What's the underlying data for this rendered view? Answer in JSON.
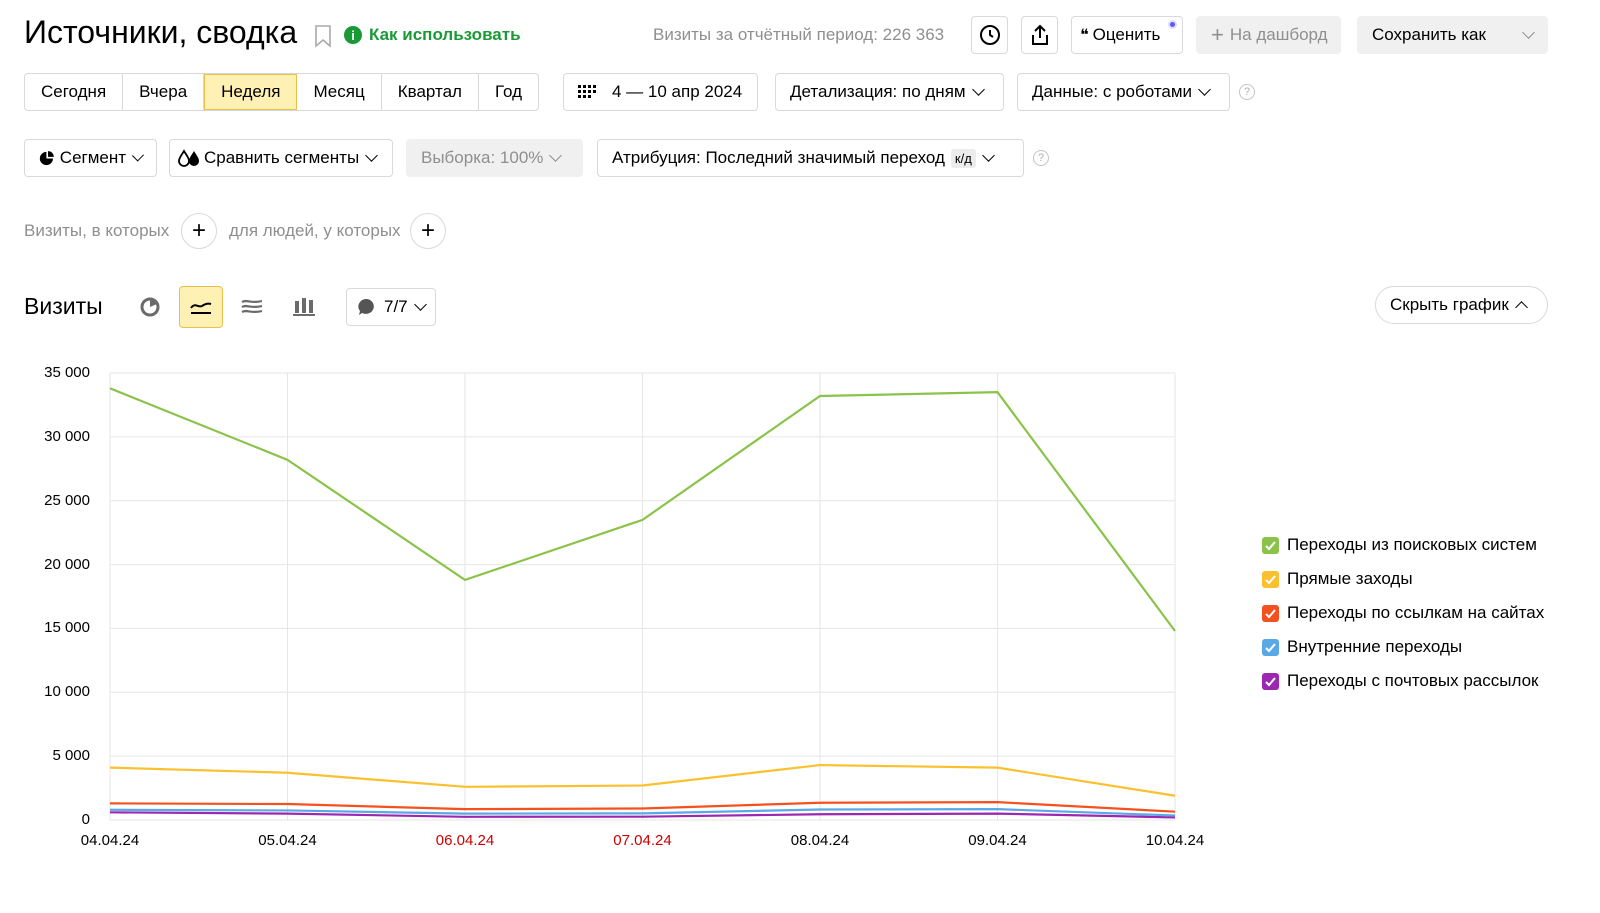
{
  "header": {
    "title": "Источники, сводка",
    "how_to_use": "Как использовать",
    "visits_period_label": "Визиты за отчётный период: 226 363",
    "rate_label": "Оценить",
    "dashboard_label": "На дашборд",
    "save_as_label": "Сохранить как"
  },
  "period_tabs": [
    "Сегодня",
    "Вчера",
    "Неделя",
    "Месяц",
    "Квартал",
    "Год"
  ],
  "active_period": "Неделя",
  "date_range": "4 — 10 апр 2024",
  "detail": "Детализация: по дням",
  "data_mode": "Данные: с роботами",
  "filters": {
    "segment": "Сегмент",
    "compare": "Сравнить сегменты",
    "sample": "Выборка: 100%",
    "attribution": "Атрибуция: Последний значимый переход",
    "attribution_badge": "к/д"
  },
  "conditions": {
    "visits_label": "Визиты, в которых",
    "people_label": "для людей, у которых"
  },
  "chart_section": {
    "title": "Визиты",
    "series_count": "7/7",
    "hide_chart": "Скрыть график"
  },
  "colors": {
    "accent_yellow": "#fff0b3",
    "green_info": "#1a9a35",
    "weekend": "#cc0000",
    "search": "#8bc34a",
    "direct": "#fbc02d",
    "links": "#f4511e",
    "internal": "#5aa9e6",
    "mail": "#9c27b0"
  },
  "chart_data": {
    "type": "line",
    "categories": [
      "04.04.24",
      "05.04.24",
      "06.04.24",
      "07.04.24",
      "08.04.24",
      "09.04.24",
      "10.04.24"
    ],
    "weekend_categories": [
      "06.04.24",
      "07.04.24"
    ],
    "y_ticks": [
      "0",
      "5 000",
      "10 000",
      "15 000",
      "20 000",
      "25 000",
      "30 000",
      "35 000"
    ],
    "ylim": [
      0,
      35000
    ],
    "grid": true,
    "legend_position": "right",
    "series": [
      {
        "name": "Переходы из поисковых систем",
        "color": "#8bc34a",
        "values": [
          33800,
          28200,
          18800,
          23500,
          33200,
          33500,
          14800
        ]
      },
      {
        "name": "Прямые заходы",
        "color": "#fbc02d",
        "values": [
          4100,
          3700,
          2600,
          2700,
          4300,
          4100,
          1900
        ]
      },
      {
        "name": "Переходы по ссылкам на сайтах",
        "color": "#f4511e",
        "values": [
          1300,
          1250,
          850,
          900,
          1350,
          1400,
          650
        ]
      },
      {
        "name": "Внутренние переходы",
        "color": "#5aa9e6",
        "values": [
          800,
          750,
          500,
          520,
          820,
          850,
          350
        ]
      },
      {
        "name": "Переходы с почтовых рассылок",
        "color": "#9c27b0",
        "values": [
          600,
          500,
          250,
          260,
          450,
          500,
          200
        ]
      }
    ]
  }
}
